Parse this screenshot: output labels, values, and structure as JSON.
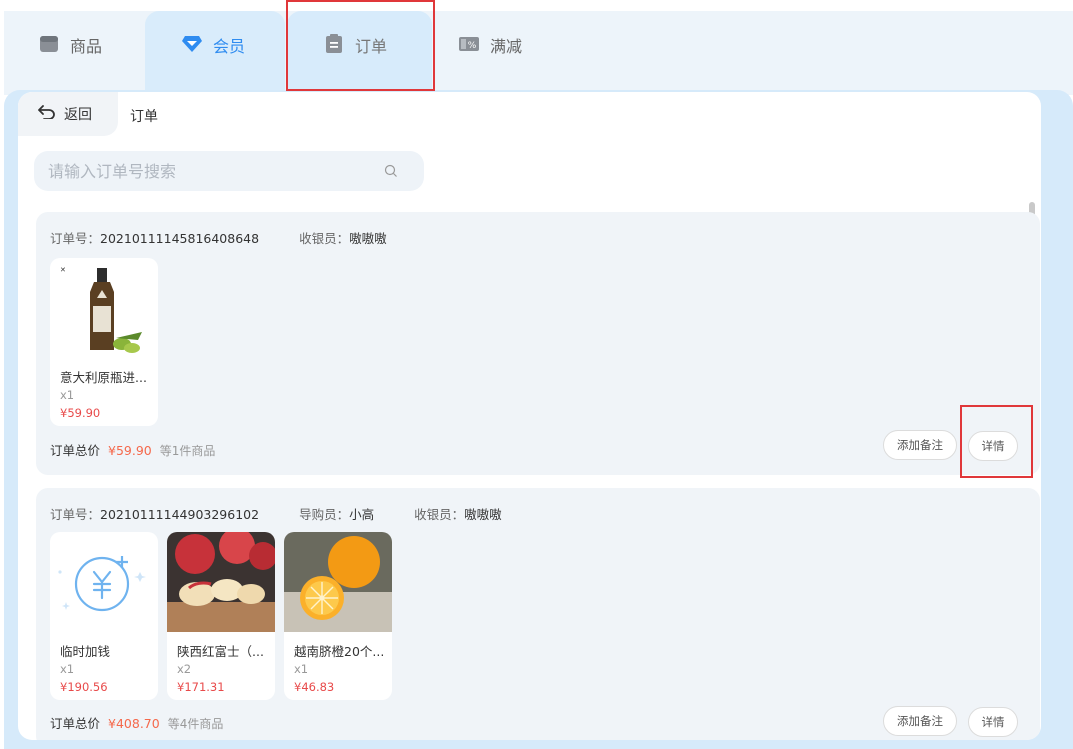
{
  "tabs": [
    {
      "label": "商品",
      "icon": "shopping-bag-icon",
      "active": false
    },
    {
      "label": "会员",
      "icon": "diamond-icon",
      "active": true
    },
    {
      "label": "订单",
      "icon": "clipboard-icon",
      "active": false
    },
    {
      "label": "满减",
      "icon": "percent-tag-icon",
      "active": false
    }
  ],
  "header": {
    "back_label": "返回",
    "title": "订单"
  },
  "search": {
    "placeholder": "请输入订单号搜索"
  },
  "orders": [
    {
      "order_no_label": "订单号：",
      "order_no": "20210111145816408648",
      "cashier_label": "收银员：",
      "cashier": "嗷嗷嗷",
      "items": [
        {
          "name": "意大利原瓶进...",
          "qty": "x1",
          "price": "¥59.90",
          "image": "olive-oil-bottle"
        }
      ],
      "total_label": "订单总价",
      "total": "¥59.90",
      "count_text": "等1件商品",
      "note_button": "添加备注",
      "detail_button": "详情"
    },
    {
      "order_no_label": "订单号：",
      "order_no": "20210111144903296102",
      "guide_label": "导购员：",
      "guide": "小高",
      "cashier_label": "收银员：",
      "cashier": "嗷嗷嗷",
      "items": [
        {
          "name": "临时加钱",
          "qty": "x1",
          "price": "¥190.56",
          "image": "yuan-plus-icon"
        },
        {
          "name": "陕西红富士（...",
          "qty": "x2",
          "price": "¥171.31",
          "image": "red-apples"
        },
        {
          "name": "越南脐橙20个...",
          "qty": "x1",
          "price": "¥46.83",
          "image": "navel-oranges"
        }
      ],
      "total_label": "订单总价",
      "total": "¥408.70",
      "count_text": "等4件商品",
      "note_button": "添加备注",
      "detail_button": "详情"
    }
  ],
  "colors": {
    "accent": "#2f8cf0",
    "price": "#e84a4a",
    "highlight": "#e0373a",
    "frame": "#d6eafa"
  }
}
